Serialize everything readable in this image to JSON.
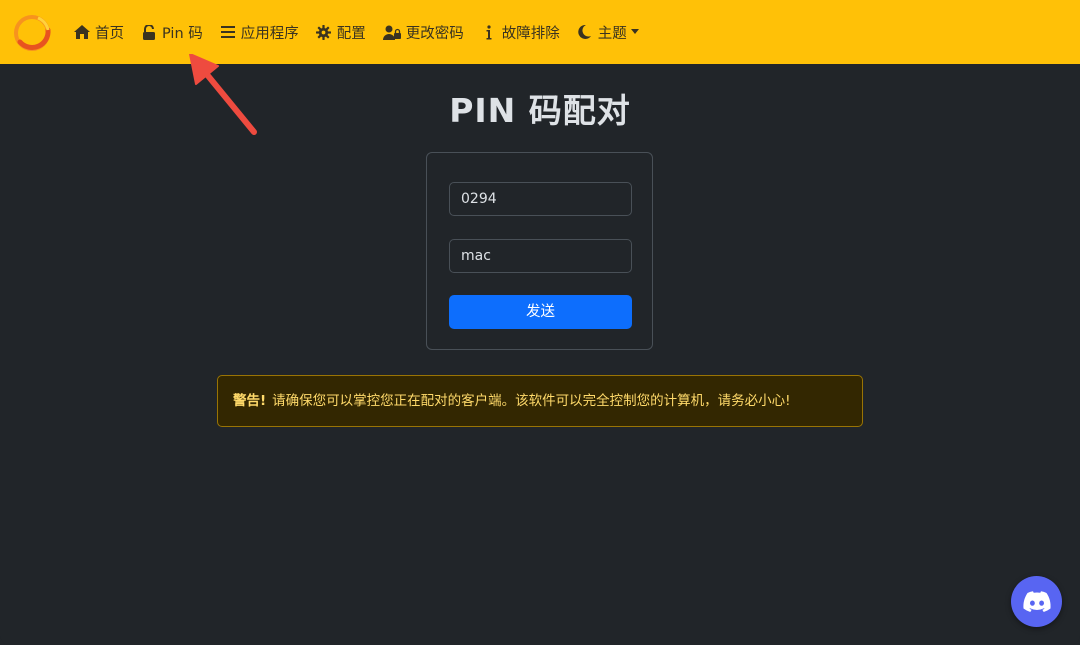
{
  "navbar": {
    "items": [
      {
        "label": "首页",
        "icon": "home-icon"
      },
      {
        "label": "Pin 码",
        "icon": "unlock-icon"
      },
      {
        "label": "应用程序",
        "icon": "list-icon"
      },
      {
        "label": "配置",
        "icon": "gear-icon"
      },
      {
        "label": "更改密码",
        "icon": "user-lock-icon"
      },
      {
        "label": "故障排除",
        "icon": "info-icon"
      },
      {
        "label": "主题",
        "icon": "moon-icon"
      }
    ],
    "background": "#ffc107"
  },
  "main": {
    "title": "PIN 码配对",
    "form": {
      "pin_value": "0294",
      "name_value": "mac",
      "send_label": "发送"
    },
    "alert": {
      "strong": "警告!",
      "text": "请确保您可以掌控您正在配对的客户端。该软件可以完全控制您的计算机，请务必小心!"
    }
  },
  "colors": {
    "background": "#212529",
    "primary_button": "#0d6efd",
    "alert_text": "#ffda6a",
    "annotation_arrow": "#ee4b3f"
  },
  "floating": {
    "icon": "discord-icon"
  }
}
